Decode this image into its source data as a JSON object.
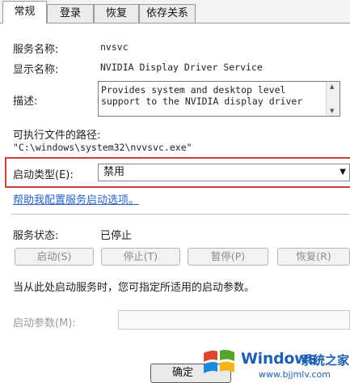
{
  "tabs": [
    {
      "label": "常规",
      "active": true
    },
    {
      "label": "登录",
      "active": false
    },
    {
      "label": "恢复",
      "active": false
    },
    {
      "label": "依存关系",
      "active": false
    }
  ],
  "general": {
    "service_name_label": "服务名称:",
    "service_name": "nvsvc",
    "display_name_label": "显示名称:",
    "display_name": "NVIDIA Display Driver Service",
    "description_label": "描述:",
    "description": "Provides system and desktop level support to the NVIDIA display driver",
    "exe_path_label": "可执行文件的路径:",
    "exe_path": "\"C:\\windows\\system32\\nvvsvc.exe\"",
    "startup_type_label": "启动类型(E):",
    "startup_type_value": "禁用",
    "help_link": "帮助我配置服务启动选项。"
  },
  "status": {
    "label": "服务状态:",
    "value": "已停止"
  },
  "buttons": {
    "start": "启动(S)",
    "stop": "停止(T)",
    "pause": "暂停(P)",
    "resume": "恢复(R)"
  },
  "params": {
    "hint": "当从此处启动服务时，您可指定所适用的启动参数。",
    "label": "启动参数(M):",
    "value": ""
  },
  "footer": {
    "ok_label": "确定"
  },
  "watermark": {
    "title": "Windows",
    "cn": "系统之家",
    "url": "www.bjjmlv.com"
  },
  "colors": {
    "highlight_frame": "#d33b3b",
    "link": "#2864c7",
    "watermark": "#1e5fb4"
  }
}
